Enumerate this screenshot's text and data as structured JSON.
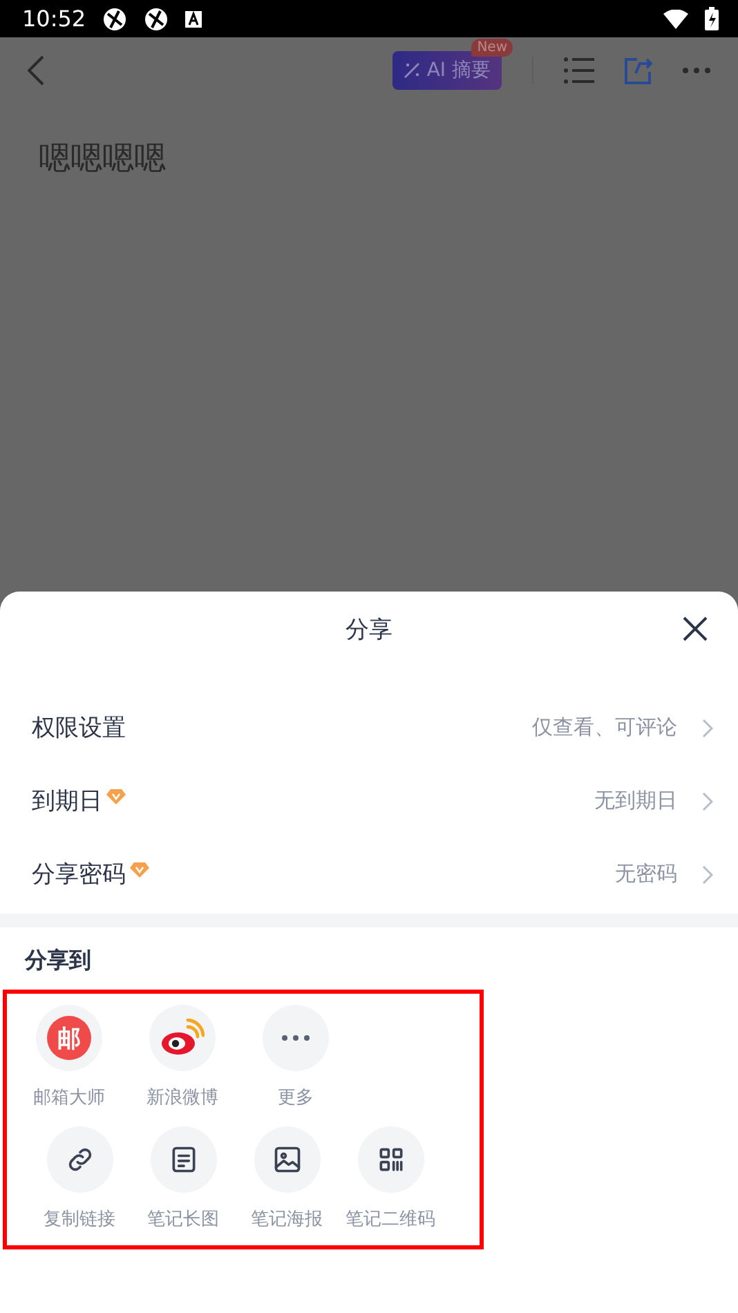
{
  "status_bar": {
    "time": "10:52"
  },
  "toolbar": {
    "ai_button": {
      "label": "AI 摘要",
      "badge": "New"
    }
  },
  "note": {
    "title": "嗯嗯嗯嗯"
  },
  "sheet": {
    "title": "分享",
    "settings": [
      {
        "label": "权限设置",
        "vip": false,
        "value": "仅查看、可评论"
      },
      {
        "label": "到期日",
        "vip": true,
        "value": "无到期日"
      },
      {
        "label": "分享密码",
        "vip": true,
        "value": "无密码"
      }
    ],
    "section_title": "分享到",
    "target_rows": [
      [
        {
          "kind": "mail",
          "glyph": "邮",
          "label": "邮箱大师"
        },
        {
          "kind": "weibo",
          "label": "新浪微博"
        },
        {
          "kind": "more",
          "label": "更多"
        }
      ],
      [
        {
          "kind": "link",
          "label": "复制链接"
        },
        {
          "kind": "longimage",
          "label": "笔记长图"
        },
        {
          "kind": "poster",
          "label": "笔记海报"
        },
        {
          "kind": "qrcode",
          "label": "笔记二维码"
        }
      ]
    ]
  }
}
